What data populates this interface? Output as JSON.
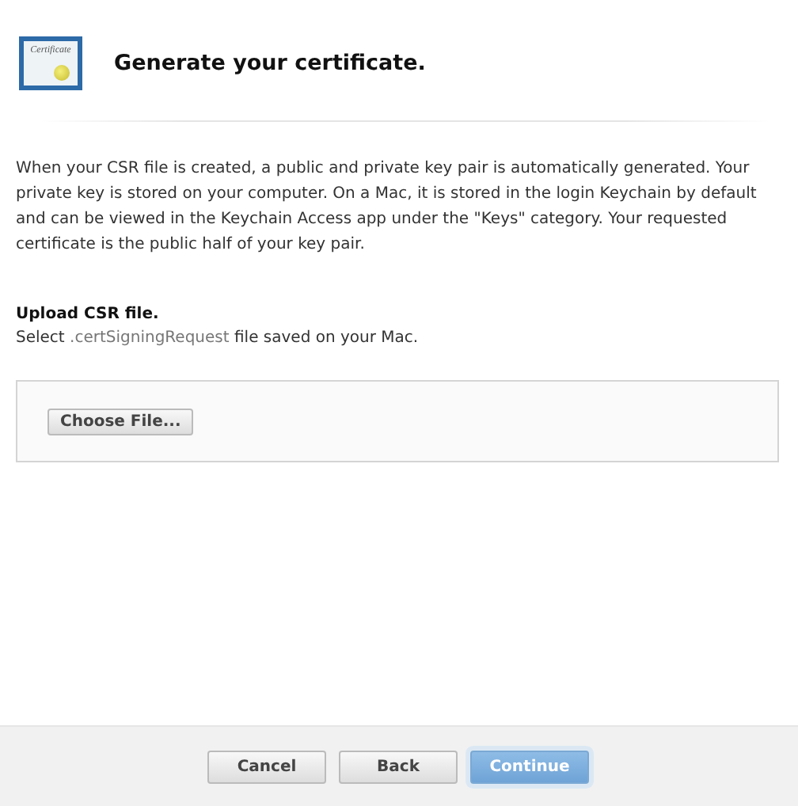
{
  "header": {
    "icon_label": "Certificate",
    "title": "Generate your certificate."
  },
  "description": "When your CSR file is created, a public and private key pair is automatically generated. Your private key is stored on your computer. On a Mac, it is stored in the login Keychain by default and can be viewed in the Keychain Access app under the \"Keys\" category. Your requested certificate is the public half of your key pair.",
  "upload": {
    "heading": "Upload CSR file.",
    "instruction_before": "Select",
    "file_type": ".certSigningRequest",
    "instruction_after": "file saved on your Mac.",
    "button": "Choose File..."
  },
  "buttons": [
    {
      "label": "Cancel",
      "kind": "default"
    },
    {
      "label": "Back",
      "kind": "default"
    },
    {
      "label": "Continue",
      "kind": "primary"
    }
  ]
}
